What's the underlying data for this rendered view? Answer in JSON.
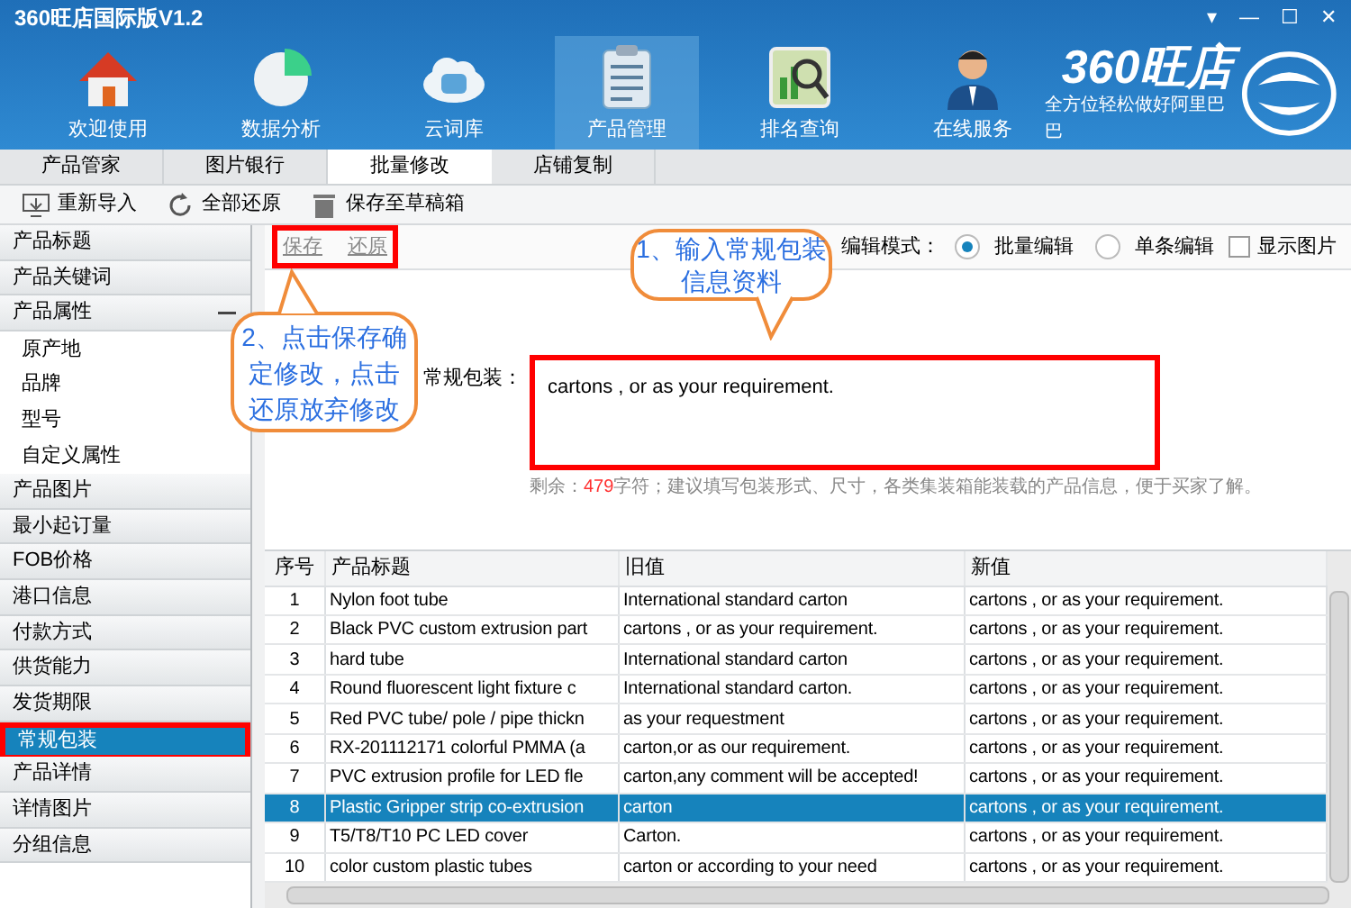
{
  "window": {
    "title": "360旺店国际版V1.2"
  },
  "nav": [
    {
      "label": "欢迎使用",
      "kind": "home",
      "selected": false
    },
    {
      "label": "数据分析",
      "kind": "pie",
      "selected": false
    },
    {
      "label": "云词库",
      "kind": "cloud",
      "selected": false
    },
    {
      "label": "产品管理",
      "kind": "clipboard",
      "selected": true
    },
    {
      "label": "排名查询",
      "kind": "chart",
      "selected": false
    },
    {
      "label": "在线服务",
      "kind": "person",
      "selected": false
    }
  ],
  "brand": {
    "name": "360旺店",
    "slogan": "全方位轻松做好阿里巴巴"
  },
  "tabs": [
    {
      "label": "产品管家",
      "selected": false
    },
    {
      "label": "图片银行",
      "selected": false
    },
    {
      "label": "批量修改",
      "selected": true
    },
    {
      "label": "店铺复制",
      "selected": false
    }
  ],
  "toolbar": [
    {
      "label": "重新导入",
      "kind": "import"
    },
    {
      "label": "全部还原",
      "kind": "restore"
    },
    {
      "label": "保存至草稿箱",
      "kind": "trash"
    }
  ],
  "sidebar": [
    {
      "label": "产品标题",
      "selected": false
    },
    {
      "label": "产品关键词",
      "selected": false
    },
    {
      "label": "产品属性",
      "selected": false,
      "expanded": true,
      "children": [
        {
          "label": "原产地",
          "selected": false
        },
        {
          "label": "品牌",
          "selected": false
        },
        {
          "label": "型号",
          "selected": false
        },
        {
          "label": "自定义属性",
          "selected": false
        }
      ]
    },
    {
      "label": "产品图片",
      "selected": false
    },
    {
      "label": "最小起订量",
      "selected": false
    },
    {
      "label": "FOB价格",
      "selected": false
    },
    {
      "label": "港口信息",
      "selected": false
    },
    {
      "label": "付款方式",
      "selected": false
    },
    {
      "label": "供货能力",
      "selected": false
    },
    {
      "label": "发货期限",
      "selected": false
    },
    {
      "label": "常规包装",
      "selected": true
    },
    {
      "label": "产品详情",
      "selected": false
    },
    {
      "label": "详情图片",
      "selected": false
    },
    {
      "label": "分组信息",
      "selected": false
    }
  ],
  "actions": [
    "保存",
    "还原"
  ],
  "edit_mode": {
    "label": "编辑模式：",
    "options": [
      {
        "label": "批量编辑",
        "selected": true
      },
      {
        "label": "单条编辑",
        "selected": false
      }
    ],
    "show_images": {
      "label": "显示图片",
      "checked": false
    }
  },
  "field": {
    "label": "常规包装：",
    "value": "cartons , or as your requirement.",
    "remaining_prefix": "剩余：",
    "remaining_count": "479",
    "remaining_suffix": "字符；建议填写包装形式、尺寸，各类集装箱能装载的产品信息，便于买家了解。"
  },
  "callouts": [
    "1、输入常规包装信息资料",
    "2、点击保存确定修改，点击还原放弃修改"
  ],
  "table": {
    "columns": [
      "序号",
      "产品标题",
      "旧值",
      "新值"
    ],
    "rows": [
      {
        "cells": [
          "1",
          "Nylon foot tube",
          "International standard carton",
          "cartons , or as your requirement."
        ],
        "selected": false
      },
      {
        "cells": [
          "2",
          "Black PVC custom extrusion part",
          "cartons , or as your requirement.",
          "cartons , or as your requirement."
        ],
        "selected": false
      },
      {
        "cells": [
          "3",
          "hard tube",
          "International standard carton",
          "cartons , or as your requirement."
        ],
        "selected": false
      },
      {
        "cells": [
          "4",
          "Round fluorescent light fixture c",
          "International standard carton.",
          "cartons , or as your requirement."
        ],
        "selected": false
      },
      {
        "cells": [
          "5",
          "Red PVC tube/ pole / pipe thickn",
          "as your requestment",
          "cartons , or as your requirement."
        ],
        "selected": false
      },
      {
        "cells": [
          "6",
          "RX-201112171 colorful PMMA (a",
          "carton,or as our requirement.",
          "cartons , or as your requirement."
        ],
        "selected": false
      },
      {
        "cells": [
          "7",
          "PVC extrusion profile for LED fle",
          "carton,any comment will be accepted!",
          "cartons , or as your requirement."
        ],
        "selected": false
      },
      {
        "cells": [
          "8",
          "Plastic Gripper strip co-extrusion",
          "carton",
          "cartons , or as your requirement."
        ],
        "selected": true
      },
      {
        "cells": [
          "9",
          "T5/T8/T10 PC LED cover",
          "Carton.",
          "cartons , or as your requirement."
        ],
        "selected": false
      },
      {
        "cells": [
          "10",
          "color custom plastic tubes",
          "carton or according to your need",
          "cartons , or as your requirement."
        ],
        "selected": false
      }
    ]
  },
  "window_controls": [
    "▾",
    "—",
    "☐",
    "✕"
  ]
}
